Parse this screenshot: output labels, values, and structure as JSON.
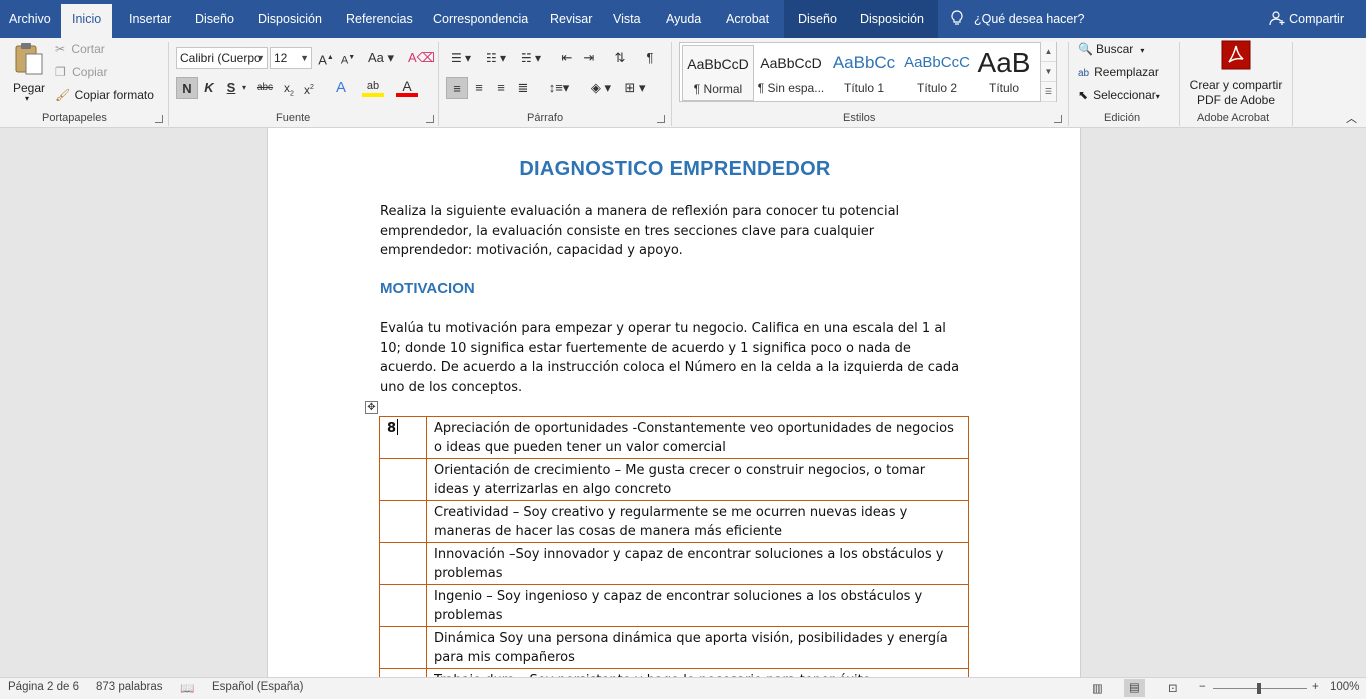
{
  "tabs": [
    "Archivo",
    "Inicio",
    "Insertar",
    "Diseño",
    "Disposición",
    "Referencias",
    "Correspondencia",
    "Revisar",
    "Vista",
    "Ayuda",
    "Acrobat"
  ],
  "context_tabs": [
    "Diseño",
    "Disposición"
  ],
  "tell_me": "¿Qué desea hacer?",
  "share": "Compartir",
  "clipboard": {
    "paste": "Pegar",
    "cut": "Cortar",
    "copy": "Copiar",
    "format_painter": "Copiar formato",
    "label": "Portapapeles"
  },
  "font": {
    "name": "Calibri (Cuerpo",
    "size": "12",
    "label": "Fuente",
    "bold": "N",
    "italic": "K",
    "underline": "S",
    "strike": "abc"
  },
  "paragraph": {
    "label": "Párrafo"
  },
  "styles": {
    "label": "Estilos",
    "items": [
      {
        "preview": "AaBbCcD",
        "name": "¶ Normal"
      },
      {
        "preview": "AaBbCcD",
        "name": "¶ Sin espa..."
      },
      {
        "preview": "AaBbCc",
        "name": "Título 1"
      },
      {
        "preview": "AaBbCcC",
        "name": "Título 2"
      },
      {
        "preview": "AaB",
        "name": "Título"
      }
    ]
  },
  "editing": {
    "find": "Buscar",
    "replace": "Reemplazar",
    "select": "Seleccionar",
    "label": "Edición"
  },
  "acrobat": {
    "line1": "Crear y compartir",
    "line2": "PDF de Adobe",
    "label": "Adobe Acrobat"
  },
  "document": {
    "title": "DIAGNOSTICO EMPRENDEDOR",
    "intro": "Realiza la siguiente evaluación a manera de reflexión para conocer tu potencial emprendedor, la evaluación consiste en tres secciones clave para cualquier emprendedor: motivación, capacidad y apoyo.",
    "section": "MOTIVACION",
    "instructions": "Evalúa tu motivación para empezar y operar tu negocio. Califica en una escala del 1 al 10; donde 10 significa estar fuertemente de acuerdo y 1 significa poco o nada de acuerdo. De acuerdo a la instrucción coloca el Número en la celda a la izquierda de cada uno de los conceptos.",
    "rows": [
      {
        "score": "8",
        "text": "Apreciación de oportunidades -Constantemente veo oportunidades de negocios o ideas que pueden tener un valor comercial"
      },
      {
        "score": "",
        "text": "Orientación de crecimiento – Me gusta crecer o construir negocios, o tomar ideas y aterrizarlas en algo concreto"
      },
      {
        "score": "",
        "text": "Creatividad – Soy creativo y regularmente se me ocurren nuevas ideas y maneras de hacer las cosas de manera más eficiente"
      },
      {
        "score": "",
        "text": "Innovación –Soy innovador y capaz de encontrar soluciones a los obstáculos y problemas"
      },
      {
        "score": "",
        "text": "Ingenio – Soy ingenioso y capaz de encontrar soluciones a los obstáculos y problemas"
      },
      {
        "score": "",
        "text": "Dinámica  Soy una persona dinámica que aporta visión, posibilidades y energía para mis compañeros"
      },
      {
        "score": "",
        "text": "Trabajo duro – Soy persistente y hago lo necesario para tener éxito"
      }
    ]
  },
  "status": {
    "page": "Página 2 de 6",
    "words": "873 palabras",
    "language": "Español (España)",
    "zoom": "100%"
  },
  "colors": {
    "ribbon_blue": "#2b579a",
    "heading_blue": "#2e74b5",
    "table_border": "#c55a11"
  }
}
